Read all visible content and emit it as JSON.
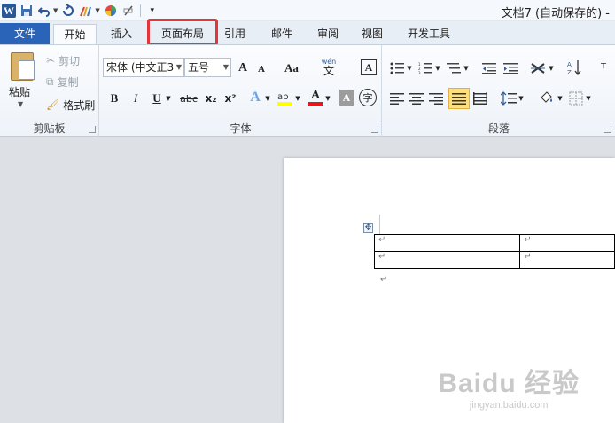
{
  "window": {
    "title": "文档7 (自动保存的) -"
  },
  "qat": {
    "logo": "W"
  },
  "tabs": [
    {
      "label": "文件"
    },
    {
      "label": "开始"
    },
    {
      "label": "插入"
    },
    {
      "label": "页面布局"
    },
    {
      "label": "引用"
    },
    {
      "label": "邮件"
    },
    {
      "label": "审阅"
    },
    {
      "label": "视图"
    },
    {
      "label": "开发工具"
    }
  ],
  "clipboard": {
    "paste": "粘贴",
    "cut": "剪切",
    "copy": "复制",
    "format_painter": "格式刷",
    "group_label": "剪贴板"
  },
  "font": {
    "family": "宋体 (中文正3",
    "size": "五号",
    "group_label": "字体",
    "grow": "A",
    "shrink": "A",
    "case": "Aa",
    "pinyin_top": "wén",
    "pinyin": "文",
    "border_char": "A",
    "bold": "B",
    "italic": "I",
    "underline": "U",
    "strike": "abc",
    "sub": "x₂",
    "sup": "x²",
    "text_effect": "A",
    "font_color": "A",
    "char_shade": "A",
    "enclose": "字"
  },
  "paragraph": {
    "group_label": "段落"
  },
  "document": {
    "table_rows": [
      [
        "↵",
        "↵"
      ],
      [
        "↵",
        "↵"
      ]
    ],
    "para_mark": "↵",
    "table_handle": "✥"
  },
  "watermark": {
    "brand": "Baidu 经验",
    "url": "jingyan.baidu.com"
  }
}
